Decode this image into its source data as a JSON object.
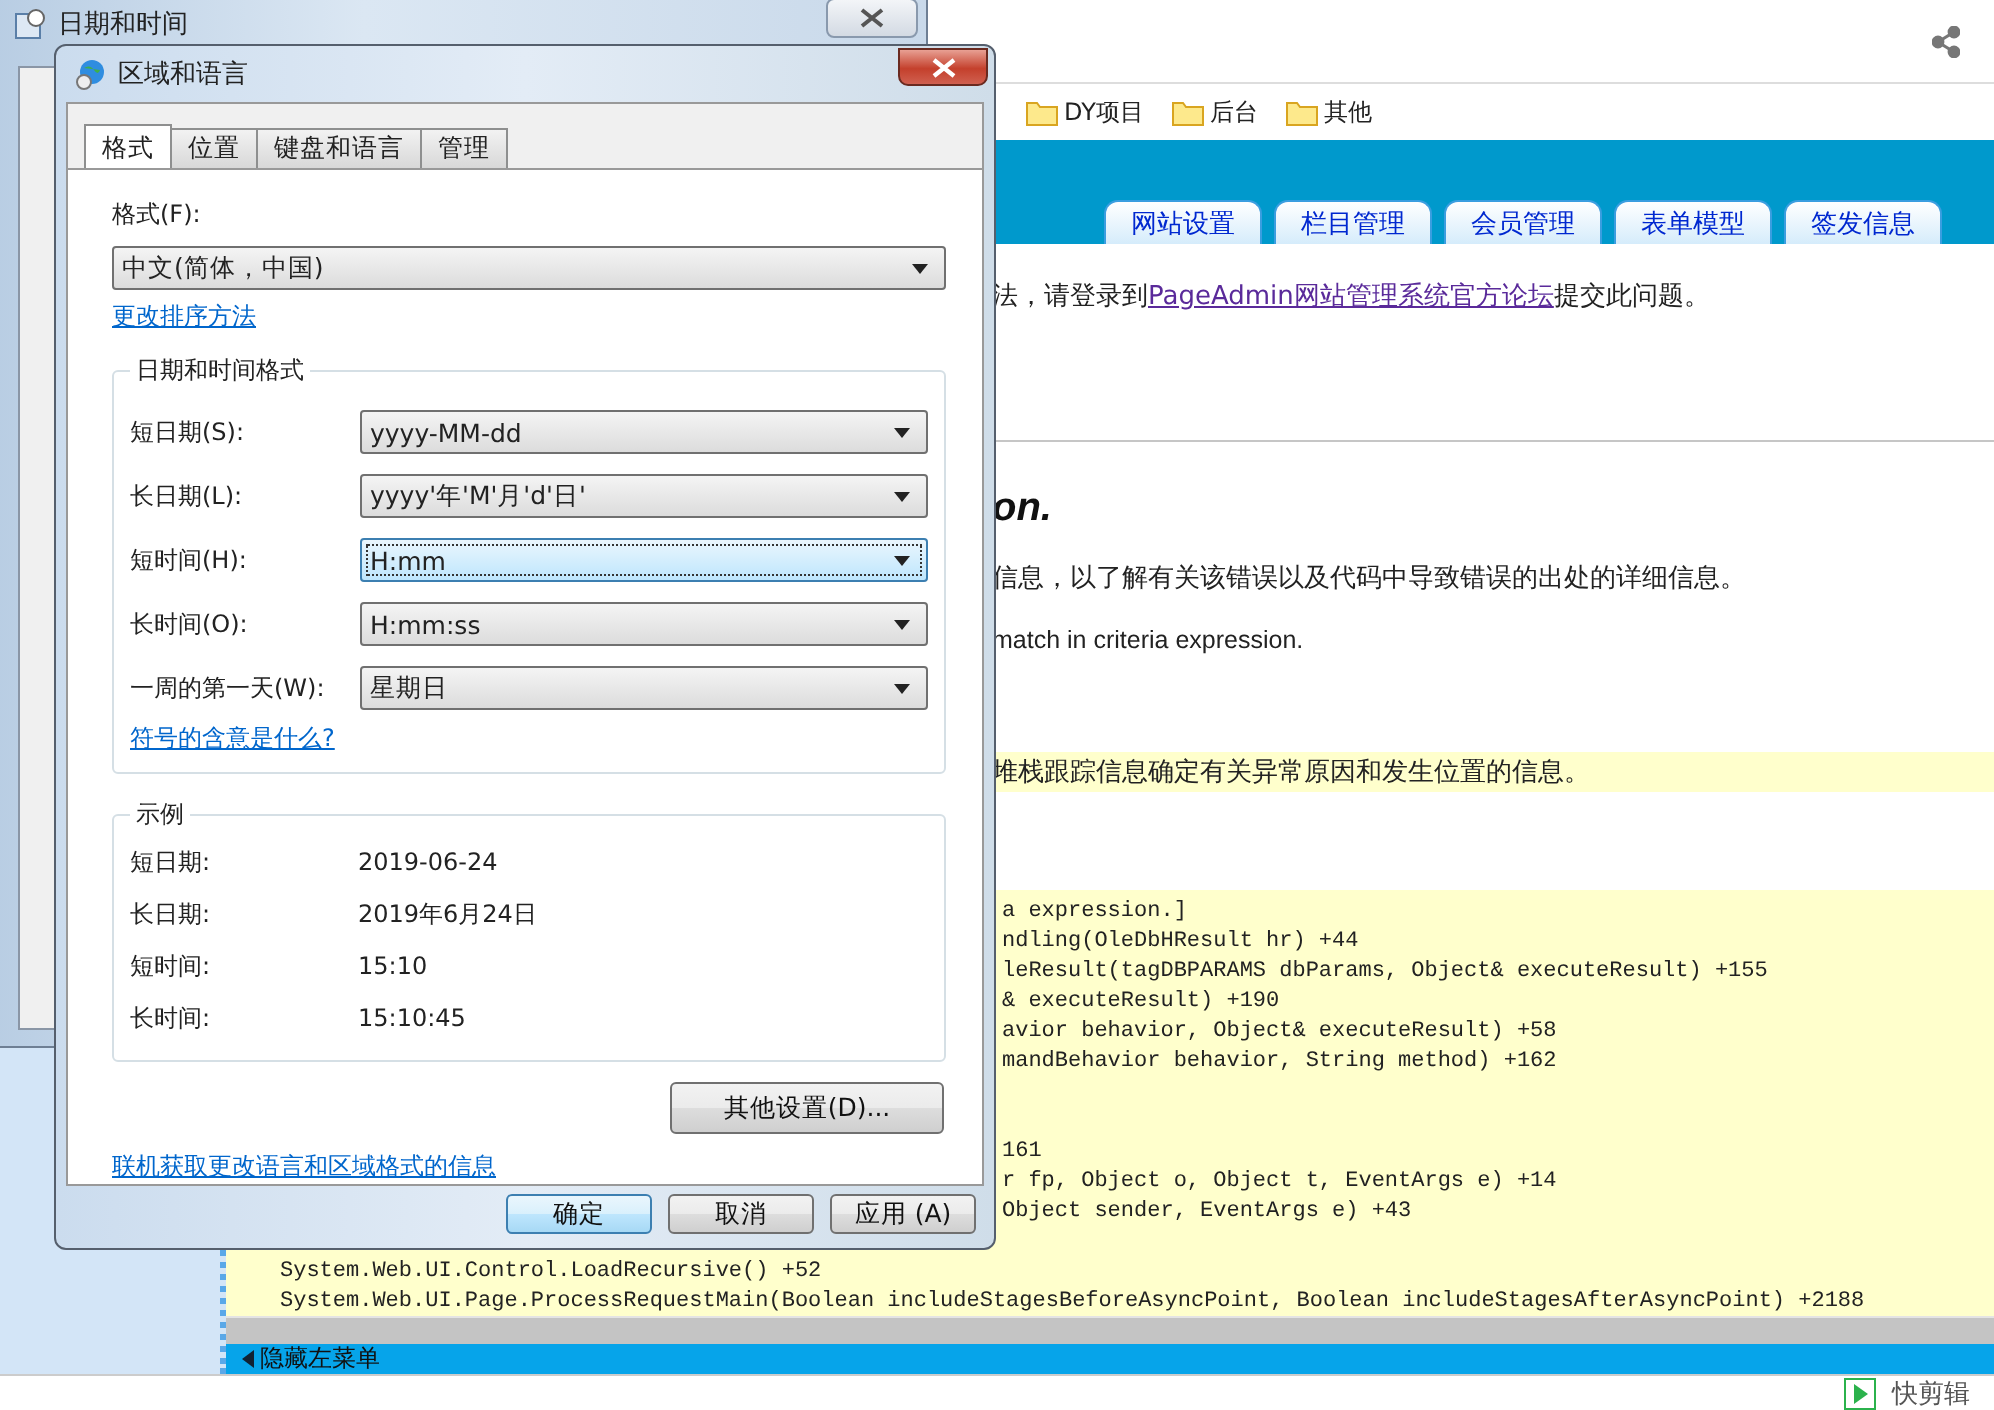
{
  "browser": {
    "bookmarks": [
      "DY项目",
      "后台",
      "其他"
    ],
    "nav_tabs": [
      "网站设置",
      "栏目管理",
      "会员管理",
      "表单模型",
      "签发信息"
    ],
    "message": {
      "before": "法，请登录到",
      "link": "PageAdmin网站管理系统官方论坛",
      "after": "提交此问题。"
    },
    "heading": "on.",
    "lines": [
      "信息，以了解有关该错误以及代码中导致错误的出处的详细信息。",
      "match in criteria expression."
    ],
    "notice": "堆栈跟踪信息确定有关异常原因和发生位置的信息。",
    "code_lines": [
      {
        "kind": "cut",
        "text": "a expression.]"
      },
      {
        "kind": "cut",
        "text": "ndling(OleDbHResult hr) +44"
      },
      {
        "kind": "cut",
        "text": "leResult(tagDBPARAMS dbParams, Object& executeResult) +155"
      },
      {
        "kind": "cut",
        "text": "& executeResult) +190"
      },
      {
        "kind": "cut",
        "text": "avior behavior, Object& executeResult) +58"
      },
      {
        "kind": "cut",
        "text": "mandBehavior behavior, String method) +162"
      },
      {
        "kind": "blank"
      },
      {
        "kind": "blank"
      },
      {
        "kind": "cut",
        "text": "161"
      },
      {
        "kind": "cut",
        "text": "r fp, Object o, Object t, EventArgs e) +14"
      },
      {
        "kind": "cut",
        "text": "Object sender, EventArgs e) +43"
      },
      {
        "kind": "blank"
      },
      {
        "kind": "full",
        "text": "System.Web.UI.Control.LoadRecursive() +52"
      },
      {
        "kind": "full",
        "text": "System.Web.UI.Page.ProcessRequestMain(Boolean includeStagesBeforeAsyncPoint, Boolean includeStagesAfterAsyncPoint) +2188"
      }
    ],
    "hide_menu": "隐藏左菜单",
    "app_label": "快剪辑"
  },
  "back_window": {
    "title": "日期和时间"
  },
  "dialog": {
    "title": "区域和语言",
    "tabs": [
      {
        "label": "格式",
        "selected": true
      },
      {
        "label": "位置",
        "selected": false
      },
      {
        "label": "键盘和语言",
        "selected": false
      },
      {
        "label": "管理",
        "selected": false
      }
    ],
    "format_label": "格式(F):",
    "format_value": "中文(简体，中国)",
    "sort_link": "更改排序方法",
    "group_title": "日期和时间格式",
    "formats": [
      {
        "label": "短日期(S):",
        "value": "yyyy-MM-dd",
        "focused": false
      },
      {
        "label": "长日期(L):",
        "value": "yyyy'年'M'月'd'日'",
        "focused": false
      },
      {
        "label": "短时间(H):",
        "value": "H:mm",
        "focused": true
      },
      {
        "label": "长时间(O):",
        "value": "H:mm:ss",
        "focused": false
      },
      {
        "label": "一周的第一天(W):",
        "value": "星期日",
        "focused": false
      }
    ],
    "symbols_link": "符号的含意是什么?",
    "example_title": "示例",
    "examples": [
      {
        "label": "短日期:",
        "value": "2019-06-24"
      },
      {
        "label": "长日期:",
        "value": "2019年6月24日"
      },
      {
        "label": "短时间:",
        "value": "15:10"
      },
      {
        "label": "长时间:",
        "value": "15:10:45"
      }
    ],
    "more_button": "其他设置(D)...",
    "online_link": "联机获取更改语言和区域格式的信息",
    "buttons": [
      {
        "label": "确定",
        "default": true
      },
      {
        "label": "取消",
        "default": false
      },
      {
        "label": "应用 (A)",
        "default": false
      }
    ]
  }
}
